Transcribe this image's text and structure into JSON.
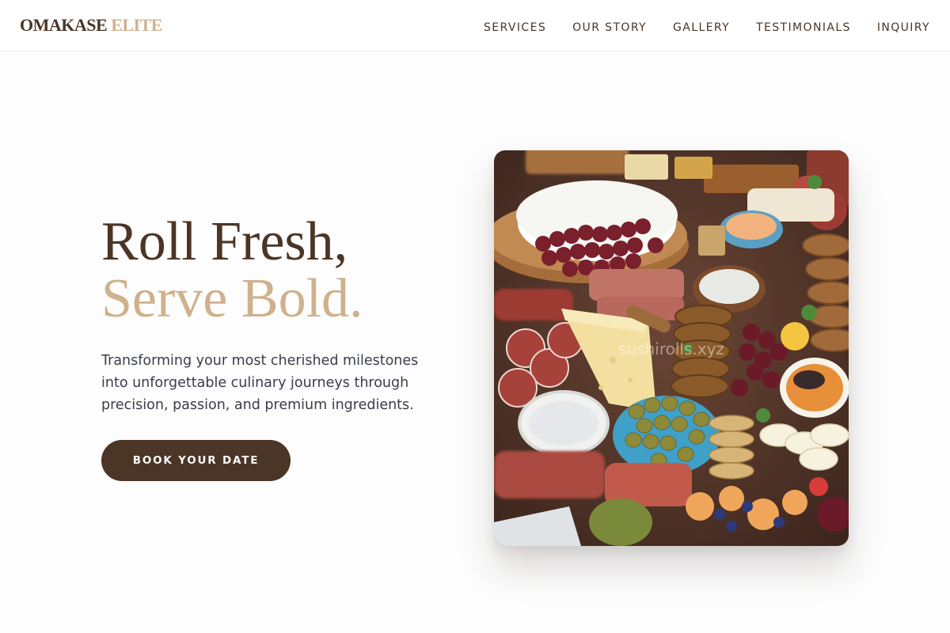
{
  "brand": {
    "name_part1": "OMAKASE",
    "name_part2": "ELITE"
  },
  "nav": {
    "items": [
      {
        "label": "SERVICES"
      },
      {
        "label": "OUR STORY"
      },
      {
        "label": "GALLERY"
      },
      {
        "label": "TESTIMONIALS"
      },
      {
        "label": "INQUIRY"
      }
    ]
  },
  "hero": {
    "headline_line1": "Roll Fresh,",
    "headline_line2": "Serve Bold.",
    "description": "Transforming your most cherished milestones into unforgettable culinary journeys through precision, passion, and premium ingredients.",
    "cta_label": "BOOK YOUR DATE",
    "image_alt": "Charcuterie board with brie, grapes, cured meats, cheese wedge, crackers, olives, dips and fruit",
    "image_watermark": "sushirolls.xyz"
  },
  "colors": {
    "brand_dark": "#4a3526",
    "brand_gold": "#d0b18c",
    "page_background": "#fdfdfd",
    "body_text": "#3b3d4a"
  }
}
